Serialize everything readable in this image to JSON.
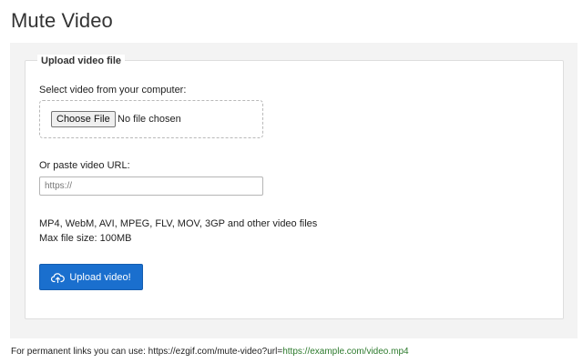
{
  "page": {
    "title": "Mute Video"
  },
  "form": {
    "legend": "Upload video file",
    "select_label": "Select video from your computer:",
    "choose_file_label": "Choose File",
    "file_status": "No file chosen",
    "url_label": "Or paste video URL:",
    "url_placeholder": "https://",
    "url_value": "",
    "formats_text": "MP4, WebM, AVI, MPEG, FLV, MOV, 3GP and other video files",
    "max_size_text": "Max file size: 100MB",
    "upload_button_label": "Upload video!",
    "upload_icon": "cloud-upload-icon"
  },
  "footer": {
    "prefix": "For permanent links you can use: https://ezgif.com/mute-video?url=",
    "example_link": "https://example.com/video.mp4"
  },
  "colors": {
    "accent": "#1a6fce",
    "panel_bg": "#f3f3f3",
    "link_green": "#2c7a2c"
  }
}
